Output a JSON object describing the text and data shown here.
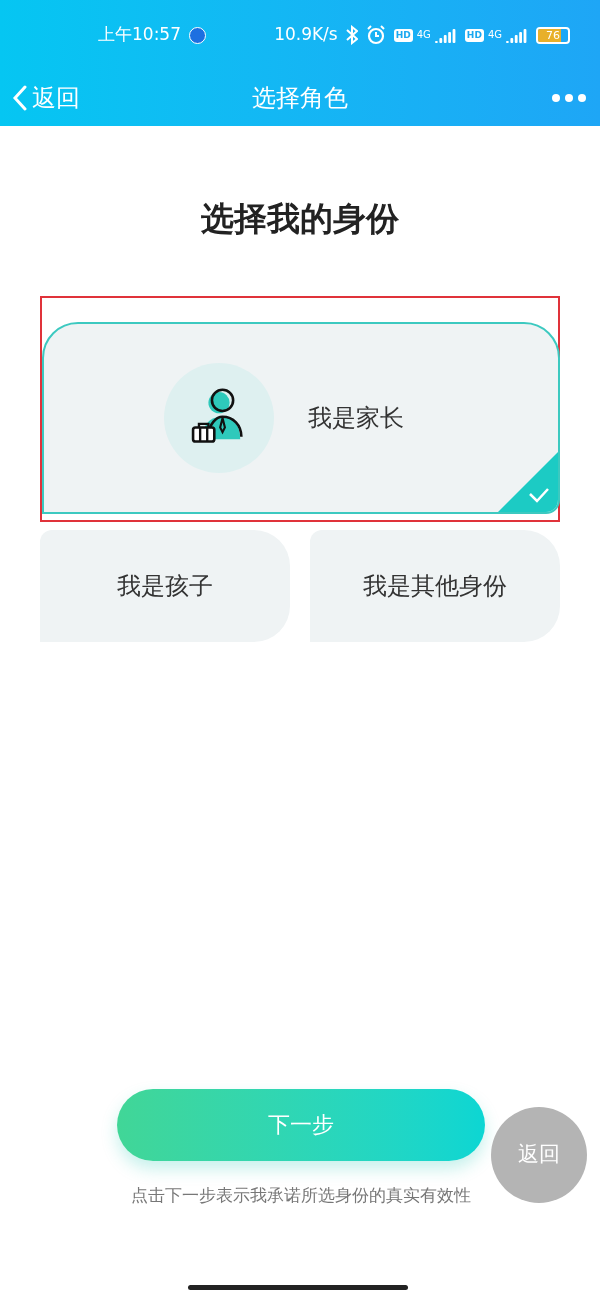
{
  "status_bar": {
    "time": "上午10:57",
    "speed": "10.9K/s",
    "sims": [
      {
        "hd": "HD",
        "network": "4G"
      },
      {
        "hd": "HD",
        "network": "4G"
      }
    ],
    "battery": "76"
  },
  "nav": {
    "back": "返回",
    "title": "选择角色"
  },
  "heading": "选择我的身份",
  "roles": [
    {
      "label": "我是家长",
      "selected": true
    },
    {
      "label": "我是孩子",
      "selected": false
    },
    {
      "label": "我是其他身份",
      "selected": false
    }
  ],
  "next_button": "下一步",
  "disclaimer": "点击下一步表示我承诺所选身份的真实有效性",
  "float_back": "返回"
}
